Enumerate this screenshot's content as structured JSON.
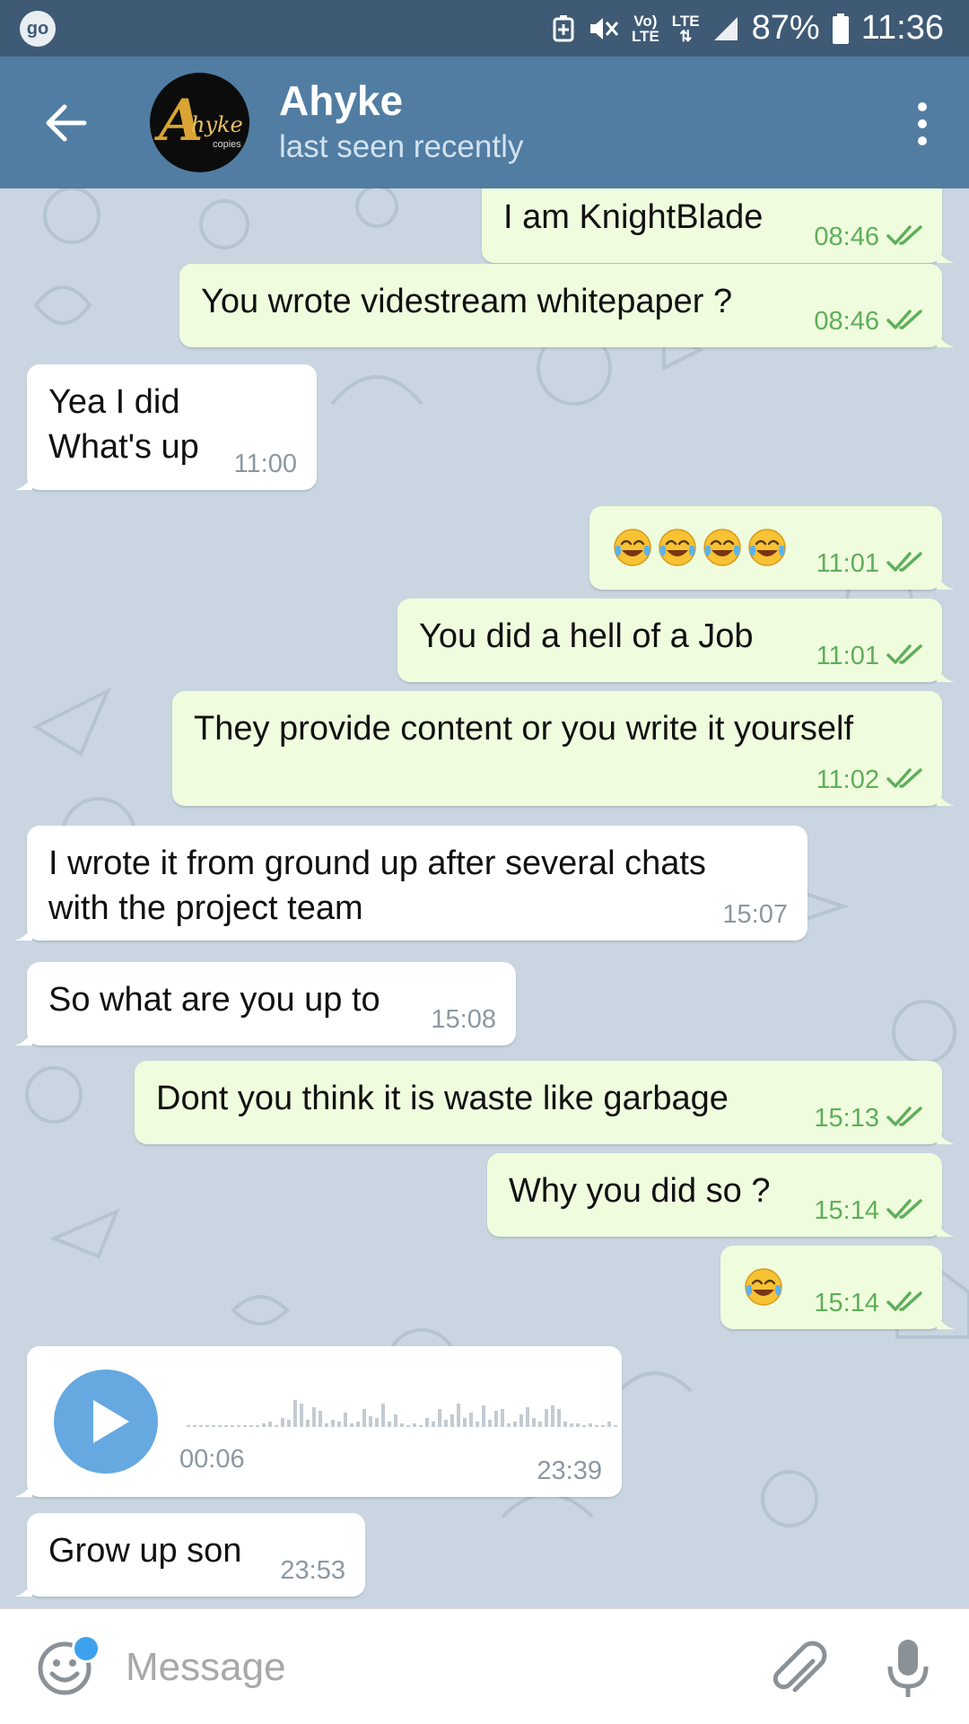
{
  "status_bar": {
    "app_badge": "go",
    "volte_top": "Vo)",
    "volte_bottom": "LTE",
    "lte": "LTE",
    "battery": "87%",
    "time": "11:36"
  },
  "header": {
    "contact_name": "Ahyke",
    "contact_status": "last seen recently",
    "avatar_letter": "A",
    "avatar_script": "hyke",
    "avatar_sub": "copies"
  },
  "messages": [
    {
      "direction": "out",
      "text": "I am KnightBlade",
      "time": "08:46",
      "read": true
    },
    {
      "direction": "out",
      "text": "You wrote videstream whitepaper ?",
      "time": "08:46",
      "read": true
    },
    {
      "direction": "in",
      "lines": [
        "Yea I did",
        "What's up"
      ],
      "time": "11:00"
    },
    {
      "direction": "out",
      "emoji_count": 4,
      "emoji": "face-with-tears-of-joy",
      "time": "11:01",
      "read": true
    },
    {
      "direction": "out",
      "text": "You did a hell of a Job",
      "time": "11:01",
      "read": true
    },
    {
      "direction": "out",
      "text": "They provide content or you write it yourself",
      "time": "11:02",
      "read": true
    },
    {
      "direction": "in",
      "lines": [
        "I wrote it from ground up after several chats",
        "with the project team"
      ],
      "time": "15:07"
    },
    {
      "direction": "in",
      "text": "So what are you up to",
      "time": "15:08"
    },
    {
      "direction": "out",
      "text": "Dont you think it is waste like garbage",
      "time": "15:13",
      "read": true
    },
    {
      "direction": "out",
      "text": "Why you did so ?",
      "time": "15:14",
      "read": true
    },
    {
      "direction": "out",
      "emoji_count": 1,
      "emoji": "face-with-tears-of-joy",
      "time": "15:14",
      "read": true
    },
    {
      "direction": "in",
      "type": "voice",
      "duration": "00:06",
      "time": "23:39"
    },
    {
      "direction": "in",
      "text": "Grow up son",
      "time": "23:53"
    }
  ],
  "input": {
    "placeholder": "Message"
  },
  "colors": {
    "status_bar": "#3f5a75",
    "header": "#517da2",
    "chat_background": "#c9d6e1",
    "bubble_out": "#effdde",
    "bubble_in": "#ffffff",
    "time_out": "#5fae5a",
    "time_in": "#8c98a1",
    "play_button": "#66a9e0"
  }
}
